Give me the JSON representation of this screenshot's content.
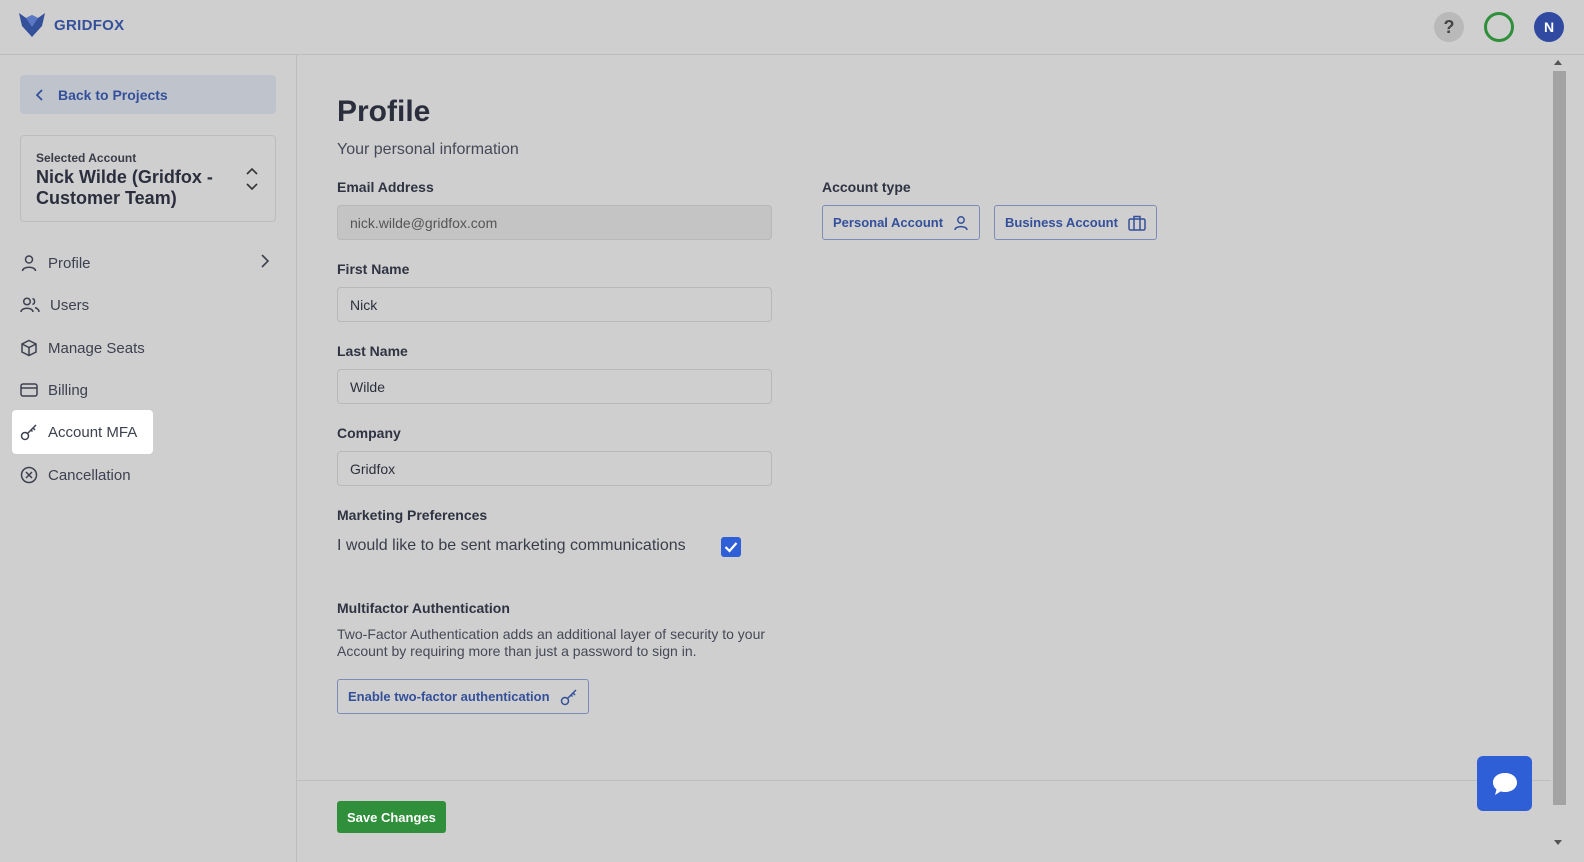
{
  "app": {
    "logo_text": "GRIDFOX"
  },
  "header": {
    "help_glyph": "?",
    "avatar_initial": "N"
  },
  "sidebar": {
    "back_label": "Back to Projects",
    "account_caption": "Selected Account",
    "account_name": "Nick Wilde (Gridfox - Customer Team)",
    "items": [
      {
        "label": "Profile",
        "icon": "user-icon"
      },
      {
        "label": "Users",
        "icon": "users-icon"
      },
      {
        "label": "Manage Seats",
        "icon": "cube-icon"
      },
      {
        "label": "Billing",
        "icon": "credit-card-icon"
      },
      {
        "label": "Account MFA",
        "icon": "key-icon"
      },
      {
        "label": "Cancellation",
        "icon": "x-circle-icon"
      }
    ]
  },
  "main": {
    "title": "Profile",
    "subtitle": "Your personal information",
    "email": {
      "label": "Email Address",
      "value": "nick.wilde@gridfox.com"
    },
    "first_name": {
      "label": "First Name",
      "value": "Nick"
    },
    "last_name": {
      "label": "Last Name",
      "value": "Wilde"
    },
    "company": {
      "label": "Company",
      "value": "Gridfox"
    },
    "account_type": {
      "label": "Account type",
      "personal_label": "Personal Account",
      "business_label": "Business Account"
    },
    "marketing": {
      "label": "Marketing Preferences",
      "text": "I would like to be sent marketing communications"
    },
    "mfa": {
      "label": "Multifactor Authentication",
      "description": "Two-Factor Authentication adds an additional layer of security to your Account by requiring more than just a password to sign in.",
      "button_label": "Enable two-factor authentication"
    },
    "save_label": "Save Changes"
  },
  "colors": {
    "brand": "#34509a",
    "accent_blue": "#2f5fd6",
    "save_green": "#2f8f3a"
  }
}
